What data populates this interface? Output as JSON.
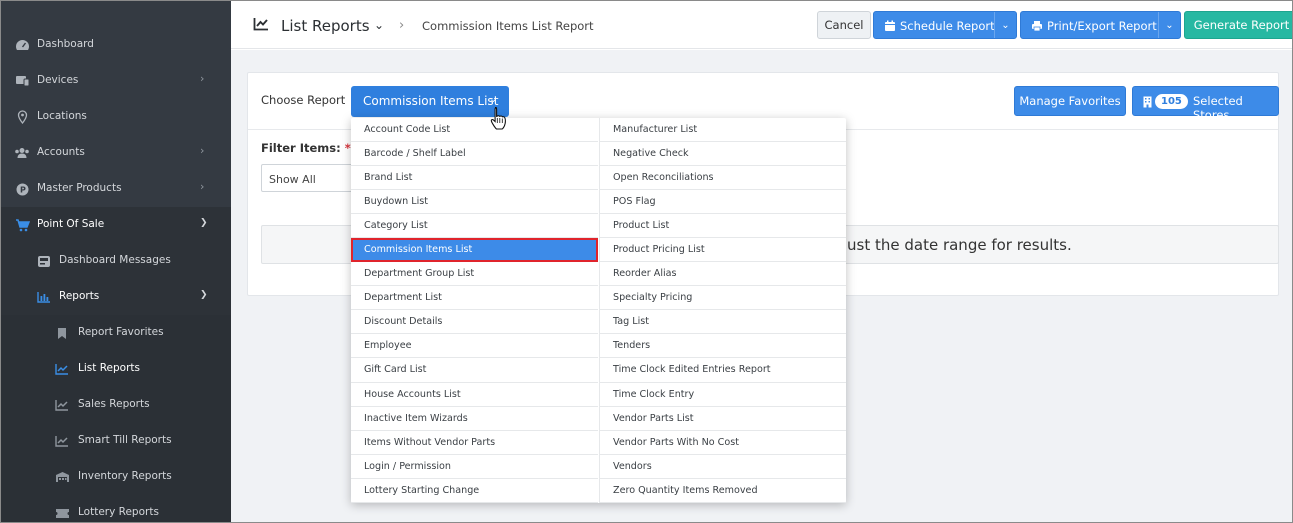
{
  "sidebar": {
    "items": [
      {
        "label": "Dashboard",
        "icon": "dashboard-icon"
      },
      {
        "label": "Devices",
        "icon": "devices-icon"
      },
      {
        "label": "Locations",
        "icon": "location-pin-icon"
      },
      {
        "label": "Accounts",
        "icon": "users-icon"
      },
      {
        "label": "Master Products",
        "icon": "product-p-icon"
      },
      {
        "label": "Point Of Sale",
        "icon": "cart-icon"
      },
      {
        "label": "Dashboard Messages",
        "icon": "messages-icon"
      },
      {
        "label": "Reports",
        "icon": "bar-chart-icon"
      },
      {
        "label": "Report Favorites",
        "icon": "bookmark-icon"
      },
      {
        "label": "List Reports",
        "icon": "line-chart-icon"
      },
      {
        "label": "Sales Reports",
        "icon": "line-chart-icon"
      },
      {
        "label": "Smart Till Reports",
        "icon": "line-chart-icon"
      },
      {
        "label": "Inventory Reports",
        "icon": "warehouse-icon"
      },
      {
        "label": "Lottery Reports",
        "icon": "ticket-icon"
      }
    ]
  },
  "header": {
    "title": "List Reports",
    "breadcrumb": "Commission Items List Report",
    "cancel_label": "Cancel",
    "schedule_label": "Schedule Report",
    "print_label": "Print/Export Report",
    "generate_label": "Generate Report"
  },
  "report": {
    "choose_label": "Choose Report",
    "selected": "Commission Items List",
    "manage_favorites_label": "Manage Favorites",
    "store_count": "105",
    "selected_stores_label": "Selected Stores",
    "filter_label": "Filter Items:",
    "filter_required": "*",
    "filter_value": "Show All",
    "message_partial": "ust the date range for results."
  },
  "dropdown": {
    "left": [
      "Account Code List",
      "Barcode / Shelf Label",
      "Brand List",
      "Buydown List",
      "Category List",
      "Commission Items List",
      "Department Group List",
      "Department List",
      "Discount Details",
      "Employee",
      "Gift Card List",
      "House Accounts List",
      "Inactive Item Wizards",
      "Items Without Vendor Parts",
      "Login / Permission",
      "Lottery Starting Change"
    ],
    "right": [
      "Manufacturer List",
      "Negative Check",
      "Open Reconciliations",
      "POS Flag",
      "Product List",
      "Product Pricing List",
      "Reorder Alias",
      "Specialty Pricing",
      "Tag List",
      "Tenders",
      "Time Clock Edited Entries Report",
      "Time Clock Entry",
      "Vendor Parts List",
      "Vendor Parts With No Cost",
      "Vendors",
      "Zero Quantity Items Removed"
    ],
    "selected_index": 5
  },
  "colors": {
    "sidebar_bg": "#343a42",
    "primary": "#3d8be8",
    "teal": "#27b8a2",
    "highlight_border": "#e0242c"
  }
}
